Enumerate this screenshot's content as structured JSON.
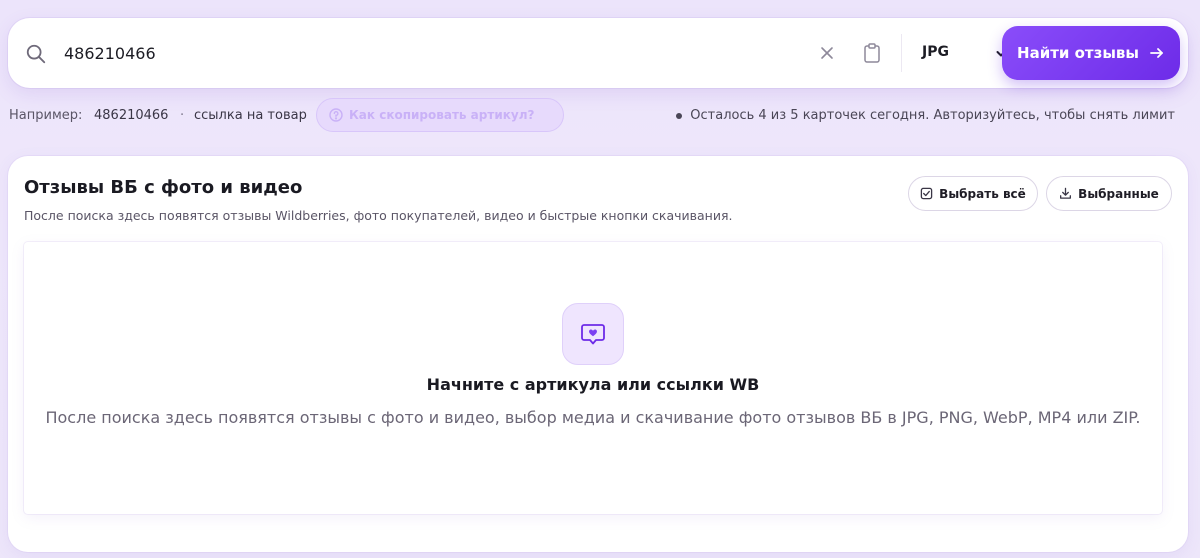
{
  "search": {
    "value": "486210466",
    "format": "JPG",
    "find_button": "Найти отзывы"
  },
  "hint": {
    "label": "Например:",
    "article": "486210466",
    "separator": "·",
    "link_text": "ссылка на товар",
    "how_to_button": "Как скопировать артикул?",
    "limit_text": "Осталось 4 из 5 карточек сегодня. Авторизуйтесь, чтобы снять лимит"
  },
  "panel": {
    "title": "Отзывы ВБ с фото и видео",
    "subtitle": "После поиска здесь появятся отзывы Wildberries, фото покупателей, видео и быстрые кнопки скачивания.",
    "select_all": "Выбрать всё",
    "selected": "Выбранные"
  },
  "empty_state": {
    "title": "Начните с артикула или ссылки WB",
    "description": "После поиска здесь появятся отзывы с фото и видео, выбор медиа и скачивание фото отзывов ВБ в JPG, PNG, WebP, MP4 или ZIP."
  },
  "icons": {
    "search": "search-icon",
    "clear": "close-icon",
    "paste": "clipboard-icon",
    "chevron": "chevron-down-icon",
    "arrow": "arrow-right-icon",
    "question": "question-icon",
    "checkbox": "checkbox-icon",
    "download": "download-icon",
    "empty": "heart-message-icon"
  },
  "colors": {
    "accent": "#7b3ff2",
    "accent_light": "#efe5fe",
    "background": "#ece4fb"
  }
}
